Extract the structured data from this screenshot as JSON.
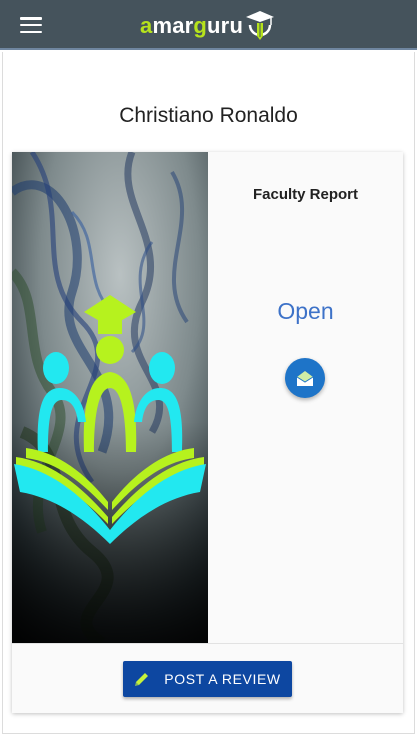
{
  "header": {
    "menu_icon": "hamburger-menu-icon",
    "logo": {
      "part1": "a",
      "part2": "mar",
      "part3": "g",
      "part4": "uru",
      "mark_icon": "graduation-pencil-icon"
    }
  },
  "profile": {
    "name": "Christiano Ronaldo"
  },
  "card": {
    "image_icon": "students-open-book-logo",
    "report_title": "Faculty Report",
    "status_label": "Open",
    "open_icon": "open-envelope-icon",
    "review_button": {
      "label": "POST A REVIEW",
      "icon": "pencil-icon"
    }
  },
  "colors": {
    "appbar": "#45535c",
    "accent_green": "#b6e31c",
    "accent_cyan": "#22e8f0",
    "link_blue": "#3d72c8",
    "button_blue": "#0d47a1"
  }
}
